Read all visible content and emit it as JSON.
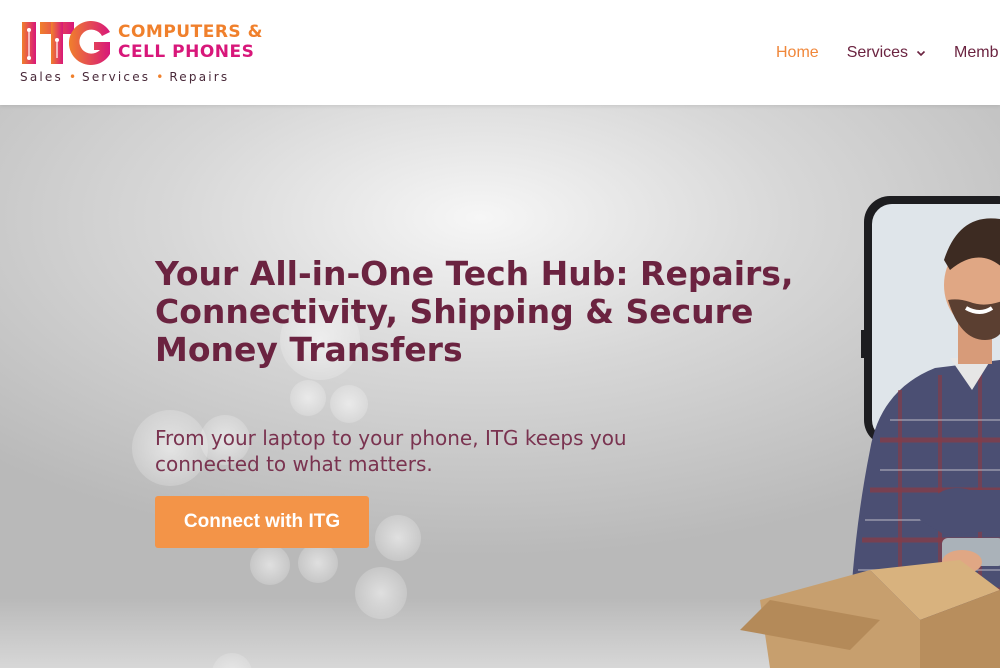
{
  "brand": {
    "mark_text": "ITG",
    "name_line1": "COMPUTERS &",
    "name_line2": "CELL PHONES",
    "tagline": [
      "Sales",
      "Services",
      "Repairs"
    ],
    "colors": {
      "orange": "#f0802c",
      "magenta": "#d8177a",
      "purple": "#6b2340"
    }
  },
  "nav": {
    "items": [
      {
        "label": "Home",
        "active": true
      },
      {
        "label": "Services",
        "has_dropdown": true
      },
      {
        "label": "Memb"
      }
    ]
  },
  "hero": {
    "title": "Your All-in-One Tech Hub: Repairs, Connectivity, Shipping & Secure Money Transfers",
    "subtitle": "From your laptop to your phone, ITG keeps you connected to what matters.",
    "cta_label": "Connect with ITG",
    "cta_color": "#f39448",
    "image_icon": "man-with-phone-and-box"
  }
}
